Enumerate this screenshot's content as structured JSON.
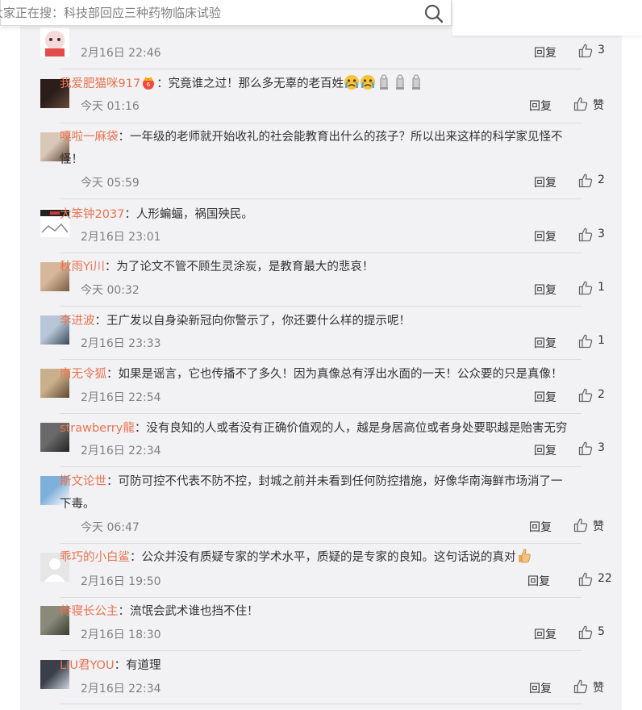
{
  "search": {
    "text": "大家正在搜：科技部回应三种药物临床试验"
  },
  "reply_label": "回复",
  "colors": {
    "username": "#eb7350",
    "panel_bg": "#f2f2f5",
    "time": "#808080",
    "divider": "#dcdcdc"
  },
  "comments": [
    {
      "user": "",
      "text": "",
      "time": "2月16日 22:46",
      "likes": "3"
    },
    {
      "user": "我爱肥猫咪917",
      "text": "：究竟谁之过！那么多无辜的老百姓",
      "time": "今天 01:16",
      "likes": "赞",
      "emojis": [
        "vip-crown-icon",
        "crying-face-icon",
        "crying-face-icon",
        "candle-icon",
        "candle-icon",
        "candle-icon"
      ]
    },
    {
      "user": "嘎啦一麻袋",
      "text": "：一年级的老师就开始收礼的社会能教育出什么的孩子？所以出来这样的科学家见怪不",
      "text2": "怪！",
      "time": "今天 05:59",
      "likes": "2"
    },
    {
      "user": "大笨钟2037",
      "text": "：人形蝙蝠，祸国殃民。",
      "time": "2月16日 23:01",
      "likes": "3"
    },
    {
      "user": "秋雨Yi川",
      "text": "：为了论文不管不顾生灵涂炭，是教育最大的悲哀！",
      "time": "今天 00:32",
      "likes": "1"
    },
    {
      "user": "李进波",
      "text": "：王广发以自身染新冠向你警示了，你还要什么样的提示呢！",
      "time": "2月16日 23:33",
      "likes": "1"
    },
    {
      "user": "南无令狐",
      "text": "：如果是谣言，它也传播不了多久！因为真像总有浮出水面的一天！公众要的只是真像！",
      "time": "2月16日 22:54",
      "likes": "2"
    },
    {
      "user": "strawberry龍",
      "text": "：没有良知的人或者没有正确价值观的人，越是身居高位或者身处要职越是贻害无穷",
      "time": "2月16日 22:34",
      "likes": "3"
    },
    {
      "user": "斯文论世",
      "text": "：可防可控不代表不防不控，封城之前并未看到任何防控措施，好像华南海鲜市场消了一",
      "text2": "下毒。",
      "time": "今天 06:47",
      "likes": "赞"
    },
    {
      "user": "乖巧的小白鲨",
      "text": "：公众并没有质疑专家的学术水平，质疑的是专家的良知。这句话说的真对",
      "time": "2月16日 19:50",
      "likes": "22",
      "emojis": [
        "thumbs-up-emoji-icon"
      ]
    },
    {
      "user": "侍寝长公主",
      "text": "：流氓会武术谁也挡不住！",
      "time": "2月16日 18:30",
      "likes": "5"
    },
    {
      "user": "LIU君YOU",
      "text": "：有道理",
      "time": "2月16日 22:34",
      "likes": "赞"
    }
  ]
}
